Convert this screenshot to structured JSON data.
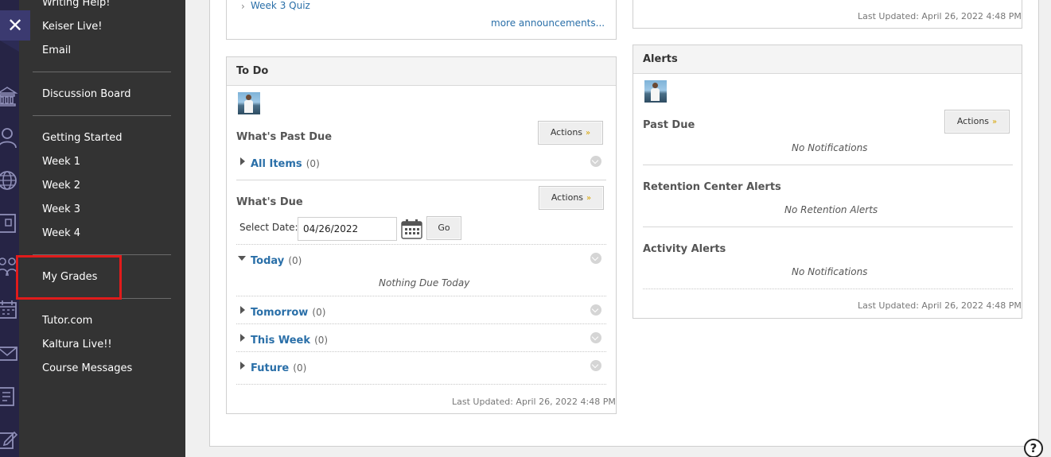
{
  "menu": {
    "items_top": [
      "Writing Help!",
      "Keiser Live!",
      "Email"
    ],
    "discussion": "Discussion Board",
    "weeks": [
      "Getting Started",
      "Week 1",
      "Week 2",
      "Week 3",
      "Week 4"
    ],
    "grades": "My Grades",
    "items_bottom": [
      "Tutor.com",
      "Kaltura Live!!",
      "Course Messages"
    ],
    "close_glyph": "✕"
  },
  "announcements": {
    "item": "Week 3 Quiz",
    "more": "more announcements..."
  },
  "todo": {
    "title": "To Do",
    "past_due": "What's Past Due",
    "actions": "Actions",
    "all_items": "All Items",
    "all_items_count": "(0)",
    "whats_due": "What's Due",
    "select_date_label": "Select Date:",
    "date_value": "04/26/2022",
    "go": "Go",
    "today": "Today",
    "today_count": "(0)",
    "nothing_due": "Nothing Due Today",
    "tomorrow": "Tomorrow",
    "tomorrow_count": "(0)",
    "this_week": "This Week",
    "this_week_count": "(0)",
    "future": "Future",
    "future_count": "(0)",
    "last_updated": "Last Updated: April 26, 2022 4:48 PM"
  },
  "top_right": {
    "last_updated": "Last Updated: April 26, 2022 4:48 PM"
  },
  "alerts": {
    "title": "Alerts",
    "actions": "Actions",
    "past_due": "Past Due",
    "no_notifications": "No Notifications",
    "retention": "Retention Center Alerts",
    "no_retention": "No Retention Alerts",
    "activity": "Activity Alerts",
    "no_activity": "No Notifications",
    "last_updated": "Last Updated: April 26, 2022 4:48 PM"
  },
  "help_glyph": "?",
  "colors": {
    "accent": "#2a6fa8",
    "menu_bg": "#333333",
    "rail_bg": "#262445",
    "highlight": "#e01b1b"
  }
}
